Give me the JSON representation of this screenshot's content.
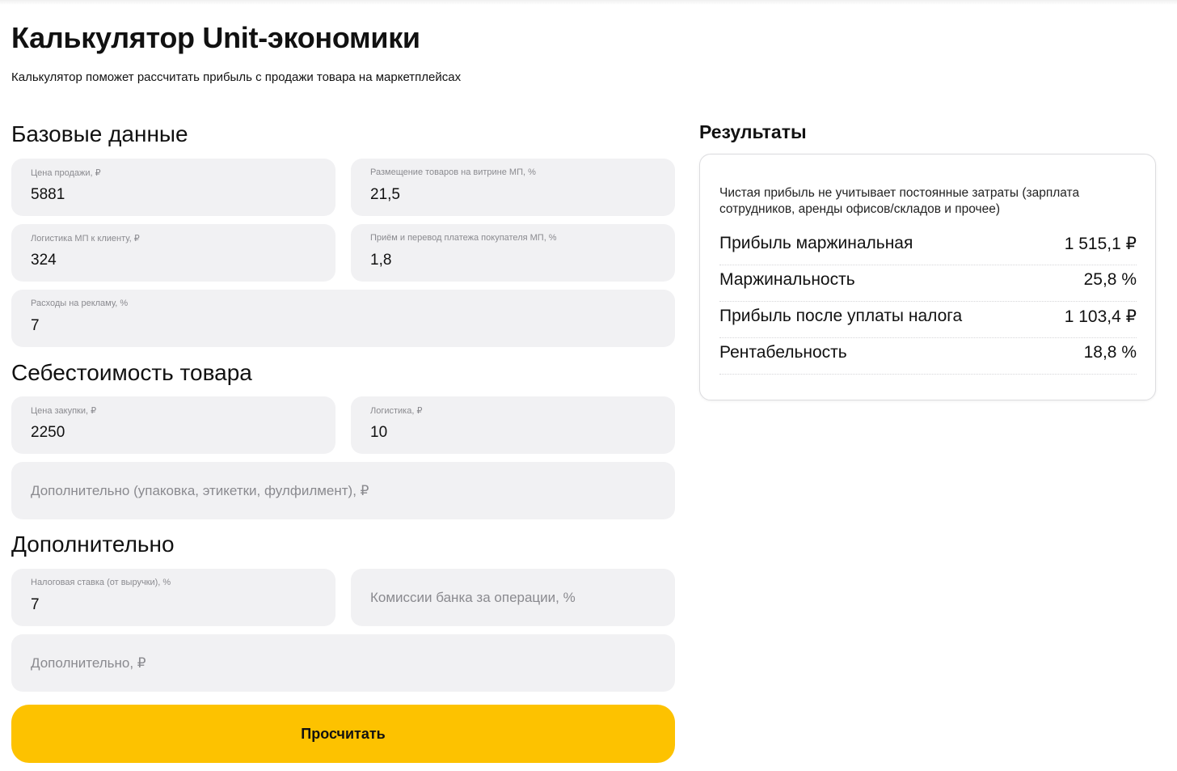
{
  "header": {
    "title": "Калькулятор Unit-экономики",
    "subtitle": "Калькулятор поможет рассчитать прибыль с продажи товара на маркетплейсах"
  },
  "base": {
    "title": "Базовые данные",
    "sale_price": {
      "label": "Цена продажи, ₽",
      "value": "5881"
    },
    "placement": {
      "label": "Размещение товаров на витрине МП, %",
      "value": "21,5"
    },
    "logistics_mp": {
      "label": "Логистика МП к клиенту, ₽",
      "value": "324"
    },
    "payment": {
      "label": "Приём и перевод платежа покупателя МП, %",
      "value": "1,8"
    },
    "ads": {
      "label": "Расходы на рекламу, %",
      "value": "7"
    }
  },
  "cost": {
    "title": "Себестоимость товара",
    "purchase_price": {
      "label": "Цена закупки, ₽",
      "value": "2250"
    },
    "logistics": {
      "label": "Логистика, ₽",
      "value": "10"
    },
    "extra": {
      "placeholder": "Дополнительно (упаковка, этикетки, фулфилмент), ₽"
    }
  },
  "additional": {
    "title": "Дополнительно",
    "tax": {
      "label": "Налоговая ставка (от выручки), %",
      "value": "7"
    },
    "bank_fee": {
      "placeholder": "Комиссии банка за операции, %"
    },
    "extra": {
      "placeholder": "Дополнительно, ₽"
    }
  },
  "actions": {
    "calculate": "Просчитать"
  },
  "results": {
    "title": "Результаты",
    "note": "Чистая прибыль не учитывает постоянные затраты (зарплата сотрудников, аренды офисов/складов и прочее)",
    "rows": [
      {
        "label": "Прибыль маржинальная",
        "value": "1 515,1 ₽"
      },
      {
        "label": "Маржинальность",
        "value": "25,8 %"
      },
      {
        "label": "Прибыль после уплаты налога",
        "value": "1 103,4 ₽"
      },
      {
        "label": "Рентабельность",
        "value": "18,8 %"
      }
    ]
  },
  "colors": {
    "accent": "#fdc200",
    "field_bg": "#f1f1f3",
    "label_gray": "#8a8a8f"
  }
}
